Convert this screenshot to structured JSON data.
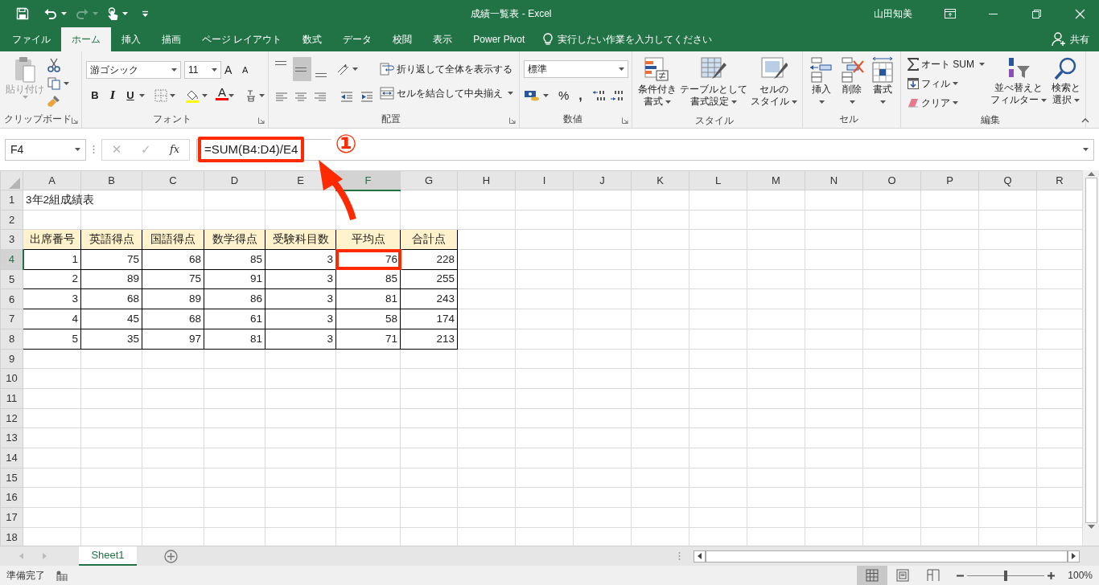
{
  "title_bar": {
    "title": "成績一覧表 - Excel",
    "user": "山田知美",
    "redo": {
      "disabled": true
    }
  },
  "ribbon_tabs": [
    {
      "label": "ファイル",
      "selected": false
    },
    {
      "label": "ホーム",
      "selected": true
    },
    {
      "label": "挿入",
      "selected": false
    },
    {
      "label": "描画",
      "selected": false
    },
    {
      "label": "ページ レイアウト",
      "selected": false
    },
    {
      "label": "数式",
      "selected": false
    },
    {
      "label": "データ",
      "selected": false
    },
    {
      "label": "校閲",
      "selected": false
    },
    {
      "label": "表示",
      "selected": false
    },
    {
      "label": "Power Pivot",
      "selected": false
    }
  ],
  "tell_me": {
    "placeholder": "実行したい作業を入力してください"
  },
  "share": "共有",
  "clipboard": {
    "label": "クリップボード",
    "paste": {
      "label": "貼り付け",
      "disabled": true
    }
  },
  "font": {
    "label": "フォント",
    "font_name": "游ゴシック",
    "font_size": "11",
    "grow": "A",
    "shrink": "A",
    "styles": [
      "B",
      "I",
      "U"
    ],
    "font_color": "A"
  },
  "alignment": {
    "label": "配置",
    "vertical": [
      {
        "kind": "top",
        "selected": false
      },
      {
        "kind": "middle",
        "selected": true
      },
      {
        "kind": "bottom",
        "selected": false
      }
    ],
    "wrap_text": "折り返して全体を表示する",
    "merge": "セルを結合して中央揃え"
  },
  "number": {
    "label": "数値",
    "format": "標準",
    "percent": "%",
    "comma": ","
  },
  "styles": {
    "label": "スタイル",
    "buttons": [
      {
        "kind": "conditional",
        "lines": [
          "条件付き",
          "書式"
        ]
      },
      {
        "kind": "table",
        "lines": [
          "テーブルとして",
          "書式設定"
        ]
      },
      {
        "kind": "cell",
        "lines": [
          "セルの",
          "スタイル"
        ]
      }
    ]
  },
  "cells": {
    "label": "セル",
    "buttons": [
      {
        "kind": "insert",
        "label": "挿入"
      },
      {
        "kind": "delete",
        "label": "削除"
      },
      {
        "kind": "format",
        "label": "書式"
      }
    ]
  },
  "editing": {
    "label": "編集",
    "autosum": "オート SUM",
    "fill": "フィル",
    "clear": "クリア",
    "buttons": [
      {
        "kind": "sort",
        "lines": [
          "並べ替えと",
          "フィルター"
        ]
      },
      {
        "kind": "find",
        "lines": [
          "検索と",
          "選択"
        ]
      }
    ]
  },
  "formula_bar": {
    "name_box": "F4",
    "cancel": "✕",
    "enter": "✓",
    "function_label": "fx",
    "formula": "=SUM(B4:D4)/E4"
  },
  "annotation": {
    "marker": "①"
  },
  "columns": [
    {
      "label": "A",
      "selected": false
    },
    {
      "label": "B",
      "selected": false
    },
    {
      "label": "C",
      "selected": false
    },
    {
      "label": "D",
      "selected": false
    },
    {
      "label": "E",
      "selected": false
    },
    {
      "label": "F",
      "selected": true
    },
    {
      "label": "G",
      "selected": false
    },
    {
      "label": "H",
      "selected": false
    },
    {
      "label": "I",
      "selected": false
    },
    {
      "label": "J",
      "selected": false
    },
    {
      "label": "K",
      "selected": false
    },
    {
      "label": "L",
      "selected": false
    },
    {
      "label": "M",
      "selected": false
    },
    {
      "label": "N",
      "selected": false
    },
    {
      "label": "O",
      "selected": false
    },
    {
      "label": "P",
      "selected": false
    },
    {
      "label": "Q",
      "selected": false
    },
    {
      "label": "R",
      "selected": false
    }
  ],
  "rows": [
    {
      "header": "1",
      "selected": false,
      "kind": "title",
      "cells": [
        {
          "text": "3年2組成績表",
          "selected": false
        }
      ]
    },
    {
      "header": "2",
      "selected": false,
      "kind": "blank"
    },
    {
      "header": "3",
      "selected": false,
      "kind": "table-header",
      "cells": [
        {
          "text": "出席番号",
          "selected": false
        },
        {
          "text": "英語得点",
          "selected": false
        },
        {
          "text": "国語得点",
          "selected": false
        },
        {
          "text": "数学得点",
          "selected": false
        },
        {
          "text": "受験科目数",
          "selected": false
        },
        {
          "text": "平均点",
          "selected": false
        },
        {
          "text": "合計点",
          "selected": false
        }
      ]
    },
    {
      "header": "4",
      "selected": true,
      "kind": "table-row",
      "cells": [
        {
          "text": "1",
          "selected": false
        },
        {
          "text": "75",
          "selected": false
        },
        {
          "text": "68",
          "selected": false
        },
        {
          "text": "85",
          "selected": false
        },
        {
          "text": "3",
          "selected": false
        },
        {
          "text": "76",
          "selected": true
        },
        {
          "text": "228",
          "selected": false
        }
      ]
    },
    {
      "header": "5",
      "selected": false,
      "kind": "table-row",
      "cells": [
        {
          "text": "2",
          "selected": false
        },
        {
          "text": "89",
          "selected": false
        },
        {
          "text": "75",
          "selected": false
        },
        {
          "text": "91",
          "selected": false
        },
        {
          "text": "3",
          "selected": false
        },
        {
          "text": "85",
          "selected": false
        },
        {
          "text": "255",
          "selected": false
        }
      ]
    },
    {
      "header": "6",
      "selected": false,
      "kind": "table-row",
      "cells": [
        {
          "text": "3",
          "selected": false
        },
        {
          "text": "68",
          "selected": false
        },
        {
          "text": "89",
          "selected": false
        },
        {
          "text": "86",
          "selected": false
        },
        {
          "text": "3",
          "selected": false
        },
        {
          "text": "81",
          "selected": false
        },
        {
          "text": "243",
          "selected": false
        }
      ]
    },
    {
      "header": "7",
      "selected": false,
      "kind": "table-row",
      "cells": [
        {
          "text": "4",
          "selected": false
        },
        {
          "text": "45",
          "selected": false
        },
        {
          "text": "68",
          "selected": false
        },
        {
          "text": "61",
          "selected": false
        },
        {
          "text": "3",
          "selected": false
        },
        {
          "text": "58",
          "selected": false
        },
        {
          "text": "174",
          "selected": false
        }
      ]
    },
    {
      "header": "8",
      "selected": false,
      "kind": "table-row",
      "cells": [
        {
          "text": "5",
          "selected": false
        },
        {
          "text": "35",
          "selected": false
        },
        {
          "text": "97",
          "selected": false
        },
        {
          "text": "81",
          "selected": false
        },
        {
          "text": "3",
          "selected": false
        },
        {
          "text": "71",
          "selected": false
        },
        {
          "text": "213",
          "selected": false
        }
      ]
    },
    {
      "header": "9",
      "selected": false,
      "kind": "blank"
    },
    {
      "header": "10",
      "selected": false,
      "kind": "blank"
    },
    {
      "header": "11",
      "selected": false,
      "kind": "blank"
    },
    {
      "header": "12",
      "selected": false,
      "kind": "blank"
    },
    {
      "header": "13",
      "selected": false,
      "kind": "blank"
    },
    {
      "header": "14",
      "selected": false,
      "kind": "blank"
    },
    {
      "header": "15",
      "selected": false,
      "kind": "blank"
    },
    {
      "header": "16",
      "selected": false,
      "kind": "blank"
    },
    {
      "header": "17",
      "selected": false,
      "kind": "blank"
    },
    {
      "header": "18",
      "selected": false,
      "kind": "blank"
    }
  ],
  "sheet_tabs": [
    {
      "label": "Sheet1",
      "selected": true
    }
  ],
  "status_bar": {
    "status": "準備完了",
    "views": [
      {
        "kind": "normal",
        "selected": true
      },
      {
        "kind": "page-layout",
        "selected": false
      },
      {
        "kind": "page-break",
        "selected": false
      }
    ],
    "zoom": {
      "level": 0.5,
      "reading": "100%"
    }
  }
}
